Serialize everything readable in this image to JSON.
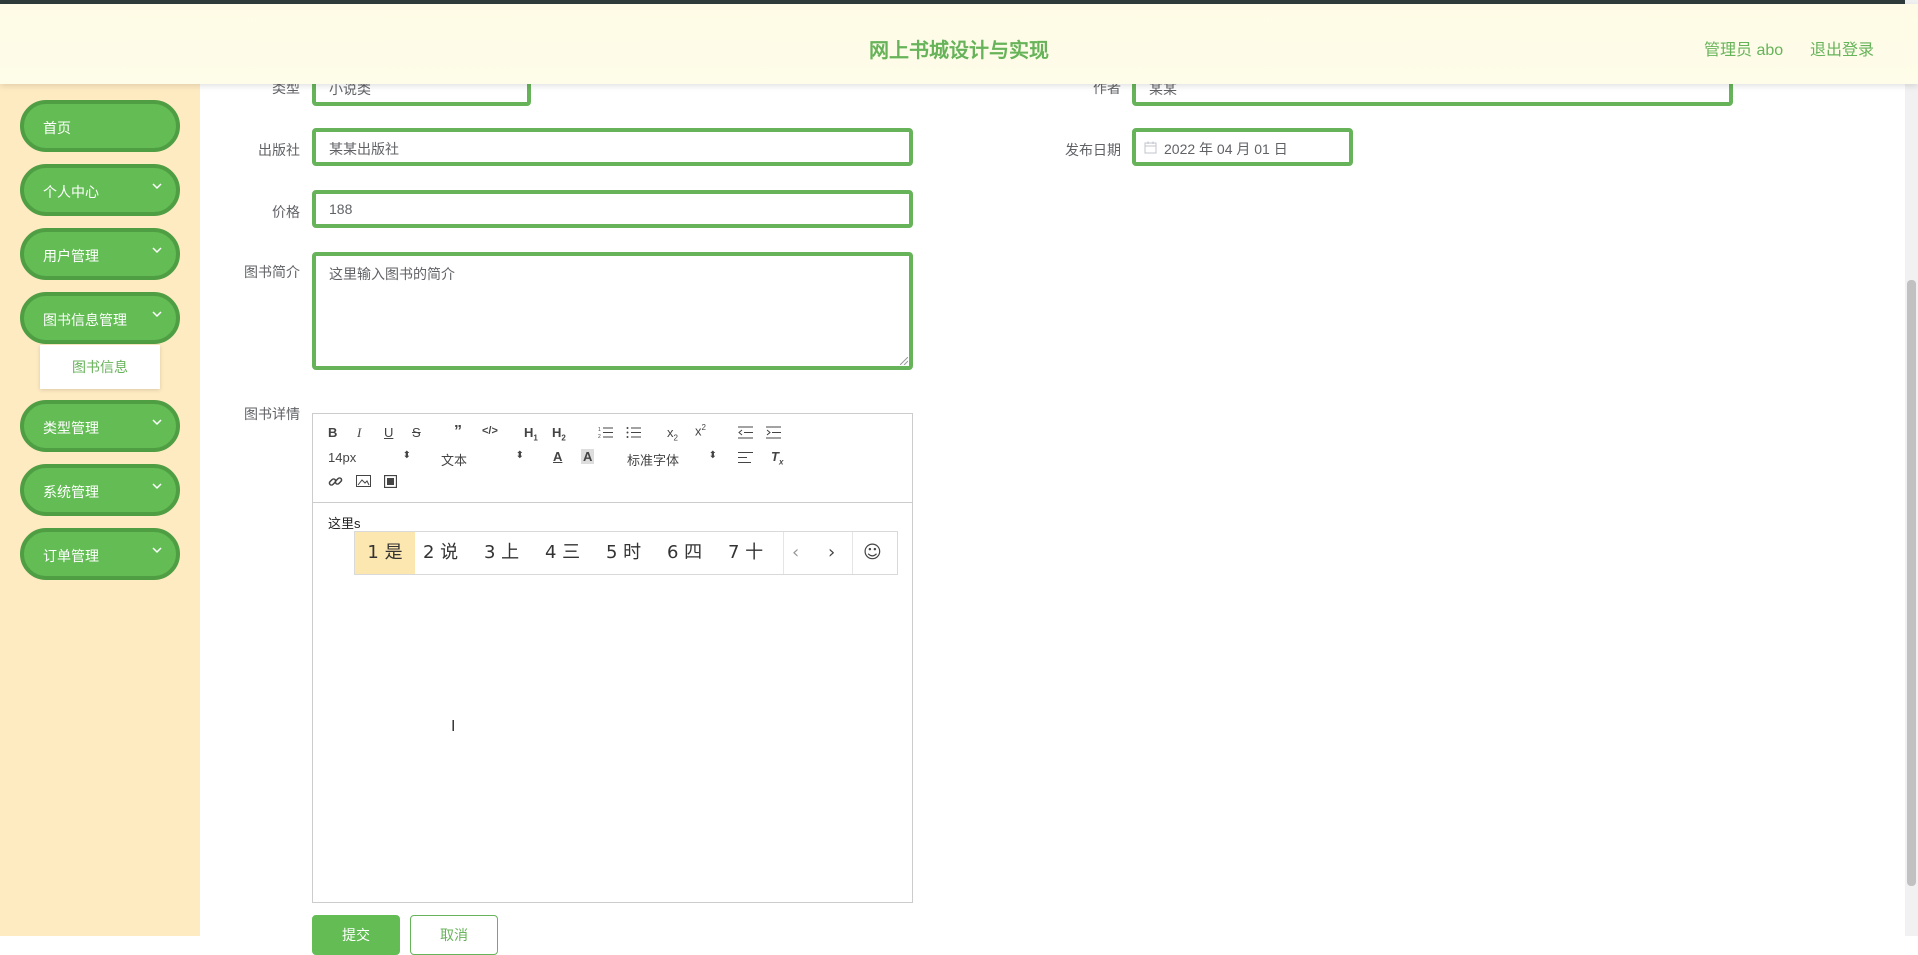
{
  "header": {
    "title": "网上书城设计与实现",
    "admin": "管理员 abo",
    "logout": "退出登录"
  },
  "sidebar": {
    "items": [
      {
        "label": "首页"
      },
      {
        "label": "个人中心"
      },
      {
        "label": "用户管理"
      },
      {
        "label": "图书信息管理"
      },
      {
        "label": "类型管理"
      },
      {
        "label": "系统管理"
      },
      {
        "label": "订单管理"
      }
    ],
    "submenu": {
      "label": "图书信息"
    }
  },
  "form": {
    "type_label": "类型",
    "type_value": "小说类",
    "author_label": "作者",
    "author_value": "某某",
    "publisher_label": "出版社",
    "publisher_value": "某某出版社",
    "date_label": "发布日期",
    "date_value": "2022 年 04 月 01 日",
    "price_label": "价格",
    "price_value": "188",
    "intro_label": "图书简介",
    "intro_value": "这里输入图书的简介",
    "detail_label": "图书详情"
  },
  "editor": {
    "font_size": "14px",
    "heading": "文本",
    "font_family": "标准字体",
    "content": "这里s",
    "ime_candidates": [
      "1 是",
      "2 说",
      "3 上",
      "4 三",
      "5 时",
      "6 四",
      "7 十"
    ]
  },
  "buttons": {
    "submit": "提交",
    "cancel": "取消"
  },
  "colors": {
    "accent": "#67b35a",
    "sidebar_bg": "#ffebc2",
    "header_bg": "#fffbe6"
  }
}
